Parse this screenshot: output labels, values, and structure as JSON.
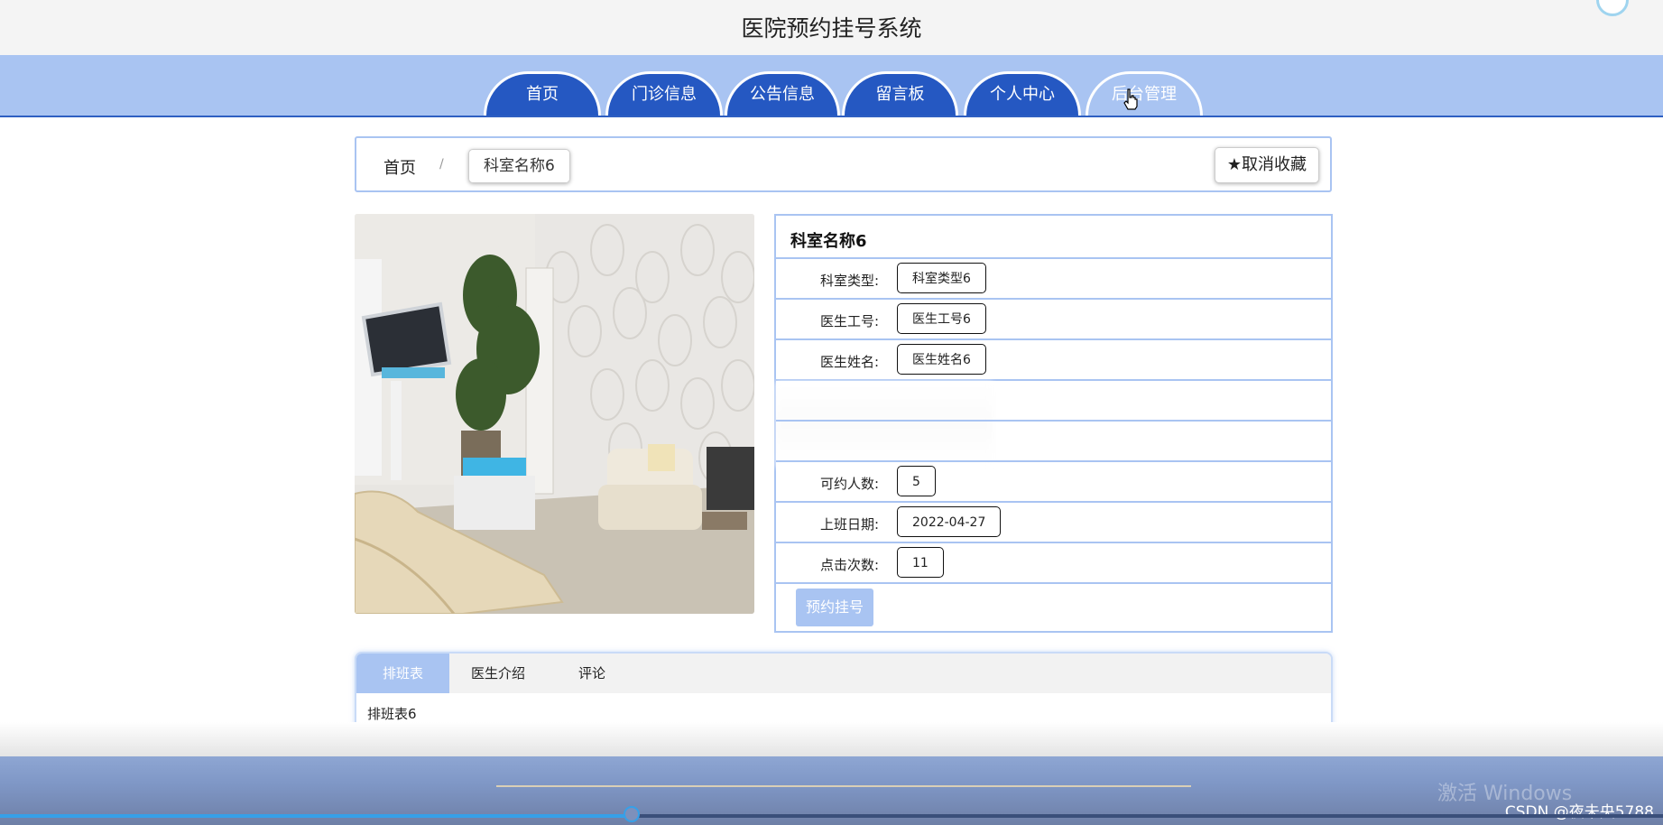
{
  "header": {
    "title": "医院预约挂号系统"
  },
  "nav": {
    "tabs": [
      {
        "label": "首页"
      },
      {
        "label": "门诊信息"
      },
      {
        "label": "公告信息"
      },
      {
        "label": "留言板"
      },
      {
        "label": "个人中心"
      },
      {
        "label": "后台管理"
      }
    ]
  },
  "breadcrumb": {
    "home": "首页",
    "separator": "/",
    "current": "科室名称6"
  },
  "favorite": {
    "label": "取消收藏",
    "icon": "star-icon"
  },
  "photo": {
    "icon": "dental-clinic-room-photo"
  },
  "detail": {
    "title": "科室名称6",
    "fields": [
      {
        "label": "科室类型:",
        "value": "科室类型6"
      },
      {
        "label": "医生工号:",
        "value": "医生工号6"
      },
      {
        "label": "医生姓名:",
        "value": "医生姓名6"
      },
      {
        "label": "可约人数:",
        "value": "5"
      },
      {
        "label": "上班日期:",
        "value": "2022-04-27"
      },
      {
        "label": "点击次数:",
        "value": "11"
      }
    ],
    "book_button": "预约挂号"
  },
  "panel": {
    "tabs": [
      {
        "label": "排班表"
      },
      {
        "label": "医生介绍"
      },
      {
        "label": "评论"
      }
    ],
    "content": "排班表6"
  },
  "player": {
    "progress": 0.38,
    "watermark": "激活 Windows",
    "credit": "CSDN @夜未央5788"
  },
  "colors": {
    "nav_bg": "#a9c4f2",
    "tab_bg": "#2558c2",
    "accent": "#36a0e8"
  }
}
